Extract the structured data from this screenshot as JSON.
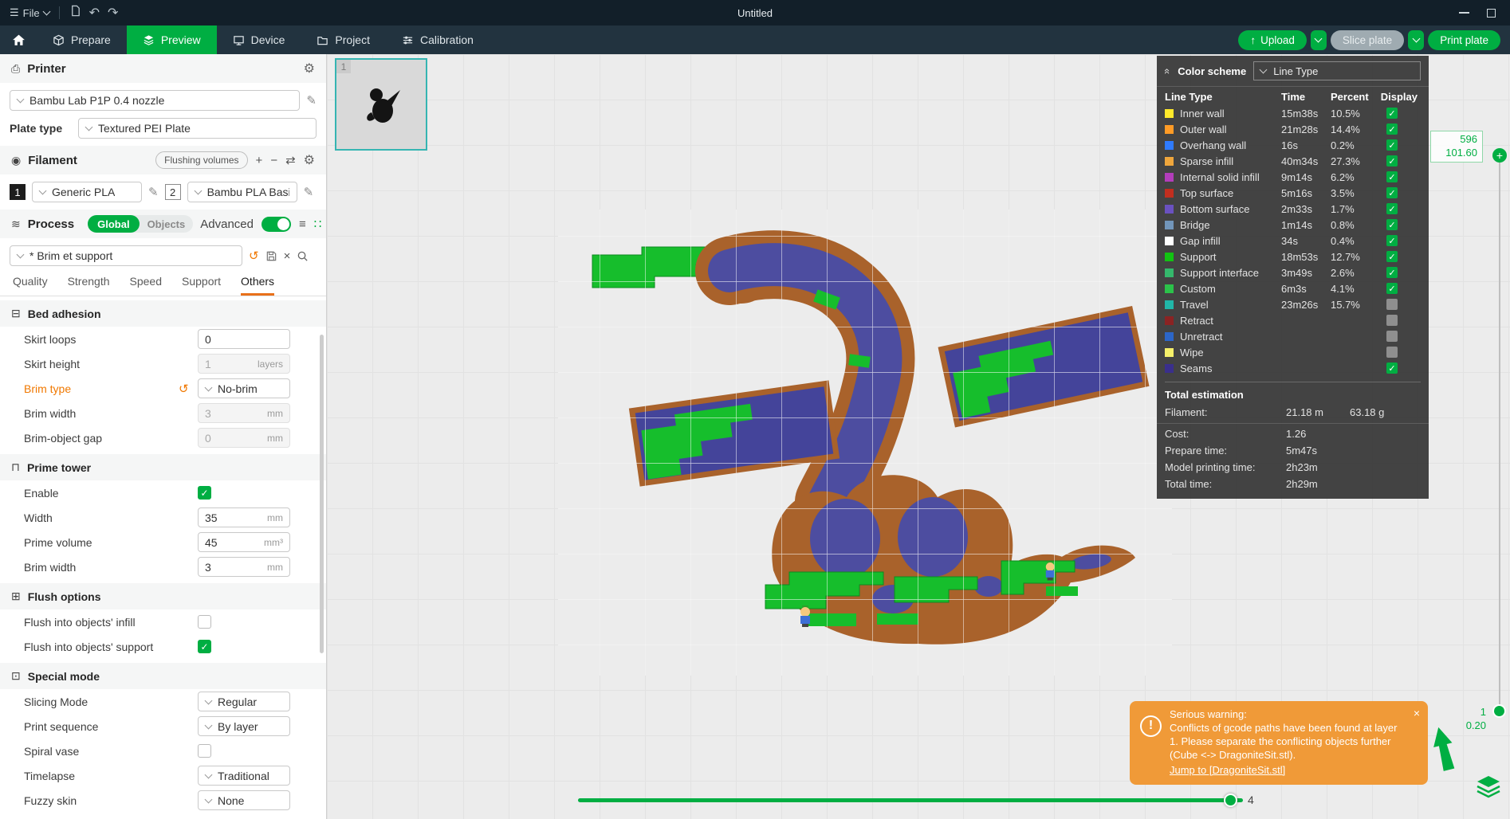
{
  "titlebar": {
    "menu": "File",
    "title": "Untitled"
  },
  "nav": {
    "tabs": [
      {
        "label": "Prepare"
      },
      {
        "label": "Preview"
      },
      {
        "label": "Device"
      },
      {
        "label": "Project"
      },
      {
        "label": "Calibration"
      }
    ],
    "upload": "Upload",
    "slice": "Slice plate",
    "print": "Print plate"
  },
  "printer": {
    "title": "Printer",
    "name": "Bambu Lab P1P 0.4 nozzle",
    "plate_type_label": "Plate type",
    "plate_type": "Textured PEI Plate"
  },
  "filament": {
    "title": "Filament",
    "flushing_volumes": "Flushing volumes",
    "slot1_num": "1",
    "slot1_name": "Generic PLA",
    "slot2_num": "2",
    "slot2_name": "Bambu PLA Basic"
  },
  "process": {
    "title": "Process",
    "global": "Global",
    "objects": "Objects",
    "advanced": "Advanced",
    "preset": "* Brim et support"
  },
  "tabs": {
    "items": [
      "Quality",
      "Strength",
      "Speed",
      "Support",
      "Others"
    ]
  },
  "settings": {
    "sections": [
      {
        "title": "Bed adhesion",
        "icon": "bed-adhesion-icon",
        "glyph": "⊟",
        "rows": [
          {
            "label": "Skirt loops",
            "type": "input",
            "value": "0",
            "unit": ""
          },
          {
            "label": "Skirt height",
            "type": "input",
            "value": "1",
            "unit": "layers",
            "disabled": true
          },
          {
            "label": "Brim type",
            "type": "select",
            "value": "No-brim",
            "modified": true
          },
          {
            "label": "Brim width",
            "type": "input",
            "value": "3",
            "unit": "mm",
            "disabled": true
          },
          {
            "label": "Brim-object gap",
            "type": "input",
            "value": "0",
            "unit": "mm",
            "disabled": true
          }
        ]
      },
      {
        "title": "Prime tower",
        "icon": "prime-tower-icon",
        "glyph": "⊓",
        "rows": [
          {
            "label": "Enable",
            "type": "checkbox",
            "checked": true
          },
          {
            "label": "Width",
            "type": "input",
            "value": "35",
            "unit": "mm"
          },
          {
            "label": "Prime volume",
            "type": "input",
            "value": "45",
            "unit": "mm³"
          },
          {
            "label": "Brim width",
            "type": "input",
            "value": "3",
            "unit": "mm"
          }
        ]
      },
      {
        "title": "Flush options",
        "icon": "flush-options-icon",
        "glyph": "⊞",
        "rows": [
          {
            "label": "Flush into objects' infill",
            "type": "checkbox",
            "checked": false
          },
          {
            "label": "Flush into objects' support",
            "type": "checkbox",
            "checked": true
          }
        ]
      },
      {
        "title": "Special mode",
        "icon": "special-mode-icon",
        "glyph": "⊡",
        "rows": [
          {
            "label": "Slicing Mode",
            "type": "select",
            "value": "Regular"
          },
          {
            "label": "Print sequence",
            "type": "select",
            "value": "By layer"
          },
          {
            "label": "Spiral vase",
            "type": "checkbox",
            "checked": false
          },
          {
            "label": "Timelapse",
            "type": "select",
            "value": "Traditional"
          },
          {
            "label": "Fuzzy skin",
            "type": "select",
            "value": "None"
          }
        ]
      }
    ]
  },
  "plate": {
    "number": "1"
  },
  "legend": {
    "title": "Color scheme",
    "scheme": "Line Type",
    "col_name": "Line Type",
    "col_time": "Time",
    "col_pct": "Percent",
    "col_disp": "Display",
    "rows": [
      {
        "name": "Inner wall",
        "color": "#FFE92B",
        "time": "15m38s",
        "pct": "10.5%",
        "display": true
      },
      {
        "name": "Outer wall",
        "color": "#FF9B26",
        "time": "21m28s",
        "pct": "14.4%",
        "display": true
      },
      {
        "name": "Overhang wall",
        "color": "#2F7BFF",
        "time": "16s",
        "pct": "0.2%",
        "display": true
      },
      {
        "name": "Sparse infill",
        "color": "#EFA63C",
        "time": "40m34s",
        "pct": "27.3%",
        "display": true
      },
      {
        "name": "Internal solid infill",
        "color": "#B33DBB",
        "time": "9m14s",
        "pct": "6.2%",
        "display": true
      },
      {
        "name": "Top surface",
        "color": "#C12E1F",
        "time": "5m16s",
        "pct": "3.5%",
        "display": true
      },
      {
        "name": "Bottom surface",
        "color": "#6A51C0",
        "time": "2m33s",
        "pct": "1.7%",
        "display": true
      },
      {
        "name": "Bridge",
        "color": "#7296BB",
        "time": "1m14s",
        "pct": "0.8%",
        "display": true
      },
      {
        "name": "Gap infill",
        "color": "#FFFFFF",
        "time": "34s",
        "pct": "0.4%",
        "display": true
      },
      {
        "name": "Support",
        "color": "#12C212",
        "time": "18m53s",
        "pct": "12.7%",
        "display": true
      },
      {
        "name": "Support interface",
        "color": "#35B86C",
        "time": "3m49s",
        "pct": "2.6%",
        "display": true
      },
      {
        "name": "Custom",
        "color": "#2BC24A",
        "time": "6m3s",
        "pct": "4.1%",
        "display": true
      },
      {
        "name": "Travel",
        "color": "#21B6A8",
        "time": "23m26s",
        "pct": "15.7%",
        "display": false
      },
      {
        "name": "Retract",
        "color": "#8B2323",
        "time": "",
        "pct": "",
        "display": false
      },
      {
        "name": "Unretract",
        "color": "#2C66C8",
        "time": "",
        "pct": "",
        "display": false
      },
      {
        "name": "Wipe",
        "color": "#F5F06A",
        "time": "",
        "pct": "",
        "display": false
      },
      {
        "name": "Seams",
        "color": "#3A2F8C",
        "time": "",
        "pct": "",
        "display": true
      }
    ],
    "total_title": "Total estimation",
    "totals": [
      {
        "label": "Filament:",
        "v1": "21.18 m",
        "v2": "63.18 g"
      },
      {
        "label": "Cost:",
        "v1": "1.26",
        "v2": ""
      },
      {
        "label": "Prepare time:",
        "v1": "5m47s",
        "v2": ""
      },
      {
        "label": "Model printing time:",
        "v1": "2h23m",
        "v2": ""
      },
      {
        "label": "Total time:",
        "v1": "2h29m",
        "v2": ""
      }
    ]
  },
  "warning": {
    "title": "Serious warning:",
    "message": "Conflicts of gcode paths have been found at layer 1. Please separate the conflicting objects further (Cube <-> DragoniteSit.stl).",
    "link": "Jump to [DragoniteSit.stl]"
  },
  "sliders": {
    "layer_top": "596",
    "height_top": "101.60",
    "layer_bottom": "1",
    "height_bottom": "0.20",
    "horizontal_value": "4"
  }
}
